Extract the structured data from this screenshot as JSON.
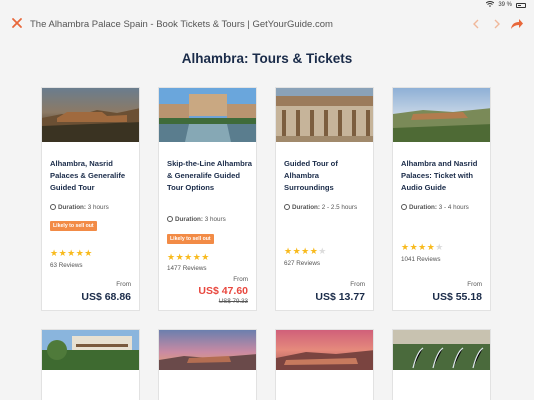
{
  "status": {
    "battery": "39 %"
  },
  "browser": {
    "title": "The Alhambra Palace Spain - Book Tickets & Tours | GetYourGuide.com"
  },
  "page": {
    "heading": "Alhambra: Tours & Tickets"
  },
  "colors": {
    "accent": "#f28b46",
    "brand": "#1a2b49",
    "sale": "#e8473e",
    "star": "#f8ba1d"
  },
  "cards": [
    {
      "name": "Alhambra, Nasrid Palaces & Generalife Guided Tour",
      "duration_label": "Duration:",
      "duration": "3 hours",
      "badge": "Likely to sell out",
      "rating": 4.5,
      "stars": "★★★★★",
      "reviews": "63 Reviews",
      "from": "From",
      "price": "US$ 68.86"
    },
    {
      "name": "Skip-the-Line Alhambra & Generalife Guided Tour Options",
      "duration_label": "Duration:",
      "duration": "3 hours",
      "badge": "Likely to sell out",
      "rating": 4.5,
      "stars": "★★★★★",
      "reviews": "1477 Reviews",
      "from": "From",
      "price": "US$ 47.60",
      "old_price": "US$ 79.33"
    },
    {
      "name": "Guided Tour of Alhambra Surroundings",
      "duration_label": "Duration:",
      "duration": "2 - 2.5 hours",
      "rating": 4,
      "stars": "★★★★",
      "stars_off": "★",
      "reviews": "627 Reviews",
      "from": "From",
      "price": "US$ 13.77"
    },
    {
      "name": "Alhambra and Nasrid Palaces: Ticket with Audio Guide",
      "duration_label": "Duration:",
      "duration": "3 - 4 hours",
      "rating": 4,
      "stars": "★★★★",
      "stars_off": "★",
      "reviews": "1041 Reviews",
      "from": "From",
      "price": "US$ 55.18"
    }
  ]
}
